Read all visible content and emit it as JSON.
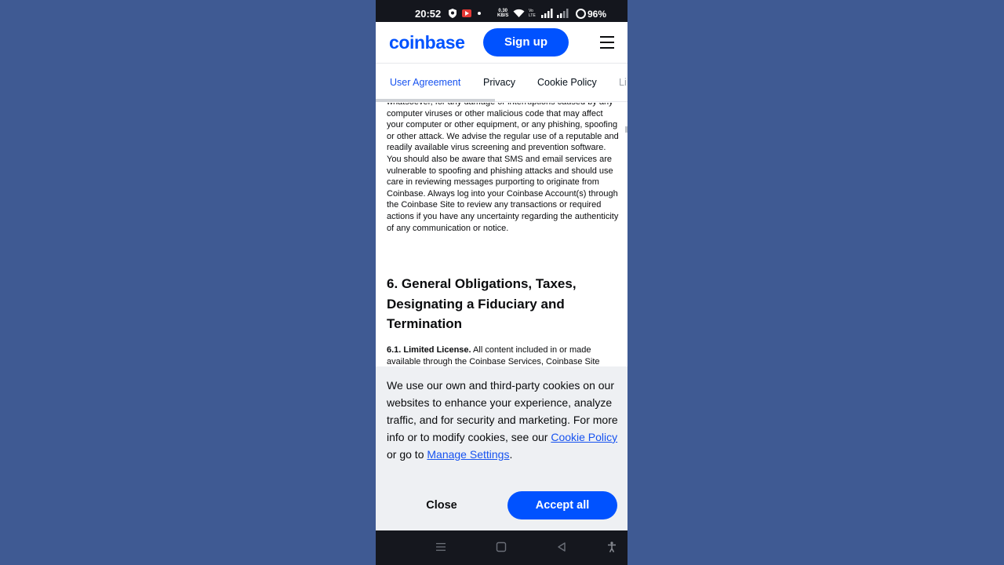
{
  "status_bar": {
    "time": "20:52",
    "net_speed_value": "0.30",
    "net_speed_unit": "KB/S",
    "volte_top": "Vo",
    "volte_bottom": "LTE",
    "battery": "96%"
  },
  "header": {
    "logo": "coinbase",
    "signup_label": "Sign up",
    "brand_color": "#0052ff"
  },
  "tabs": [
    {
      "label": "User Agreement",
      "active": true
    },
    {
      "label": "Privacy"
    },
    {
      "label": "Cookie Policy"
    },
    {
      "label": "Li"
    }
  ],
  "content": {
    "paragraph": "whatsoever, for any damage or interruptions caused by any computer viruses or other malicious code that may affect your computer or other equipment, or any phishing, spoofing or other attack. We advise the regular use of a reputable and readily available virus screening and prevention software. You should also be aware that SMS and email services are vulnerable to spoofing and phishing attacks and should use care in reviewing messages purporting to originate from Coinbase. Always log into your Coinbase Account(s) through the Coinbase Site to review any transactions or required actions if you have any uncertainty regarding the authenticity of any communication or notice.",
    "section_title": "6. General Obligations, Taxes, Designating a Fiduciary and Termination",
    "subsection_label": "6.1. Limited License.",
    "subsection_text": " All content included in or made available through the Coinbase Services, Coinbase Site"
  },
  "cookie_banner": {
    "text_before": "We use our own and third-party cookies on our websites to enhance your experience, analyze traffic, and for security and marketing. For more info or to modify cookies, see our ",
    "cookie_policy_link": "Cookie Policy",
    "text_middle": " or go to ",
    "manage_settings_link": "Manage Settings",
    "text_after": ".",
    "close_label": "Close",
    "accept_label": "Accept all"
  },
  "nav_bar": {
    "icons": [
      "recent-apps-icon",
      "home-icon",
      "back-icon",
      "accessibility-icon"
    ]
  }
}
